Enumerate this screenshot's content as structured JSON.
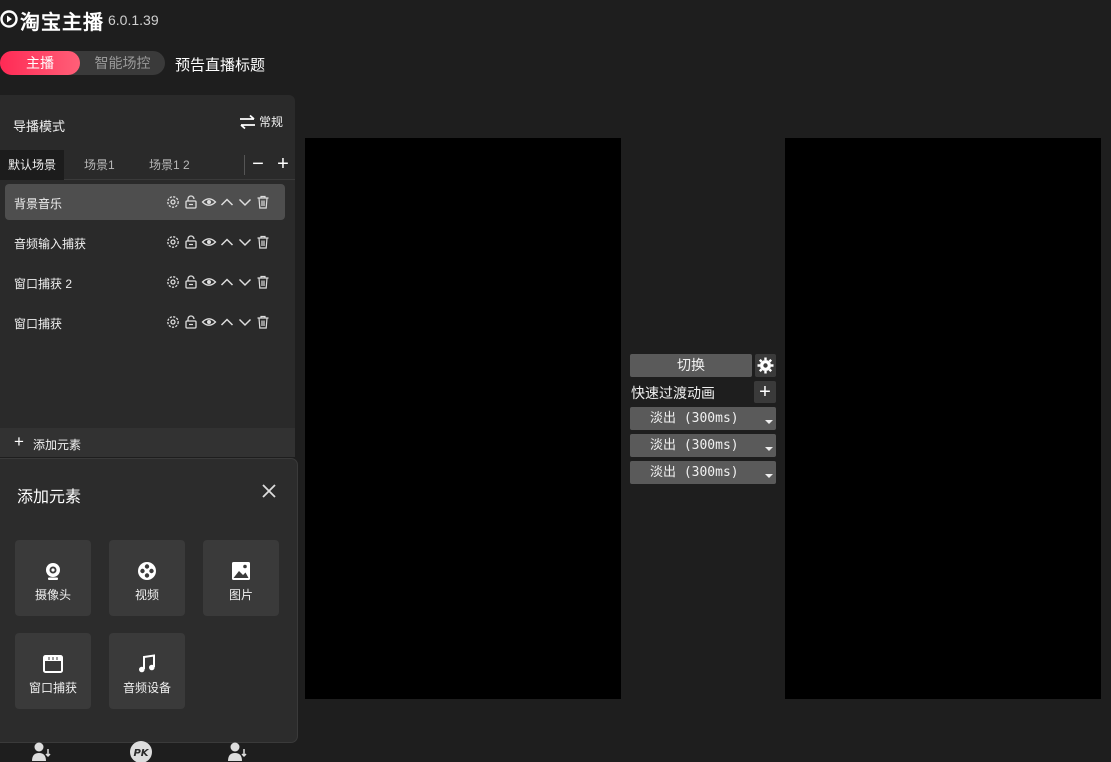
{
  "app": {
    "title": "淘宝主播",
    "version": "6.0.1.39",
    "logo_icon": "taobao-anchor-logo-icon"
  },
  "mode_toggle": {
    "active_label": "主播",
    "other_label": "智能场控",
    "accent_color": "#ff2a55"
  },
  "preview_title": "预告直播标题",
  "panel": {
    "header_label": "导播模式",
    "mode_switch_label": "常规",
    "scene_tabs": [
      {
        "label": "默认场景"
      },
      {
        "label": "场景1"
      },
      {
        "label": "场景1 2"
      }
    ],
    "scene_remove": "−",
    "scene_add": "+",
    "sources": [
      {
        "label": "背景音乐"
      },
      {
        "label": "音频输入捕获"
      },
      {
        "label": "窗口捕获 2"
      },
      {
        "label": "窗口捕获"
      }
    ],
    "source_icons": [
      "gear-icon",
      "lock-icon",
      "eye-icon",
      "chevron-up-icon",
      "chevron-down-icon",
      "trash-icon"
    ],
    "add_element_label": "添加元素"
  },
  "popup": {
    "title": "添加元素",
    "tiles": [
      {
        "label": "摄像头",
        "icon": "webcam-icon"
      },
      {
        "label": "视频",
        "icon": "film-reel-icon"
      },
      {
        "label": "图片",
        "icon": "image-icon"
      },
      {
        "label": "窗口捕获",
        "icon": "window-icon"
      },
      {
        "label": "音频设备",
        "icon": "music-note-icon"
      }
    ]
  },
  "dock": {
    "icons": [
      "user-connect-icon",
      "pk-icon",
      "user-connect-icon"
    ],
    "pk_label": "PK"
  },
  "transition": {
    "switch_label": "切换",
    "quick_label": "快速过渡动画",
    "add_symbol": "+",
    "options": [
      "淡出 (300ms)",
      "淡出 (300ms)",
      "淡出 (300ms)"
    ]
  }
}
